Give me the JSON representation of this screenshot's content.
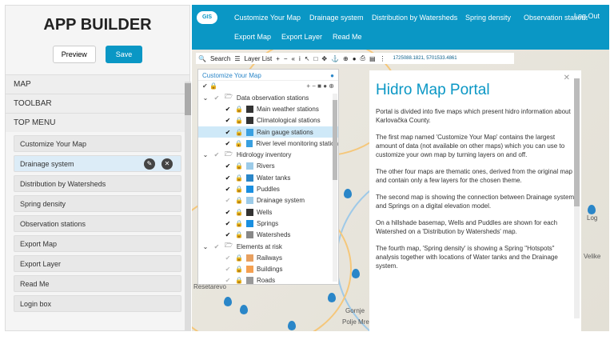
{
  "builder": {
    "title": "APP BUILDER",
    "preview": "Preview",
    "save": "Save",
    "sections": [
      "MAP",
      "TOOLBAR",
      "TOP MENU"
    ],
    "menu_items": [
      "Customize Your Map",
      "Drainage system",
      "Distribution by Watersheds",
      "Spring density",
      "Observation stations",
      "Export Map",
      "Export Layer",
      "Read Me",
      "Login box"
    ],
    "selected": "Drainage system"
  },
  "nav": {
    "logo": "GIS",
    "items": [
      "Customize Your Map",
      "Drainage system",
      "Distribution by Watersheds",
      "Spring density",
      "Observation stations",
      "Export Map",
      "Export Layer",
      "Read Me"
    ],
    "logout": "Log Out"
  },
  "toolbar": {
    "search": "Search",
    "layer_list": "Layer List",
    "coords": "1725088.1821, 5701533.4861"
  },
  "layers": {
    "title": "Customize Your Map",
    "groups": [
      {
        "name": "Data observation stations",
        "items": [
          {
            "name": "Main weather stations",
            "on": true
          },
          {
            "name": "Climatological stations",
            "on": true
          },
          {
            "name": "Rain gauge stations",
            "on": true,
            "selected": true
          },
          {
            "name": "River level monitoring station",
            "on": true
          }
        ]
      },
      {
        "name": "Hidrology inventory",
        "items": [
          {
            "name": "Rivers",
            "on": true
          },
          {
            "name": "Water tanks",
            "on": true
          },
          {
            "name": "Puddles",
            "on": true
          },
          {
            "name": "Drainage system",
            "on": false
          },
          {
            "name": "Wells",
            "on": true
          },
          {
            "name": "Springs",
            "on": true
          },
          {
            "name": "Watersheds",
            "on": true
          }
        ]
      },
      {
        "name": "Elements at risk",
        "items": [
          {
            "name": "Railways",
            "on": false
          },
          {
            "name": "Buildings",
            "on": false
          },
          {
            "name": "Roads",
            "on": false
          }
        ]
      }
    ]
  },
  "map_labels": [
    "Rešetarevo",
    "Gornje",
    "Polje Mrež",
    "Log",
    "Velike"
  ],
  "portal": {
    "title": "Hidro Map Portal",
    "paragraphs": [
      "Portal is divided into five maps which present hidro information about Karlovačka County.",
      "The first map named 'Customize Your Map' contains the largest amount of data (not available on other maps) which you can use to customize your own map by turning layers on and off.",
      "The other four maps are thematic ones, derived from the original map and contain only a few layers for the chosen theme.",
      "The second map is showing the connection between Drainage system and Springs on a digital elevation model.",
      "On a hillshade basemap, Wells and Puddles are shown for each Watershed on a 'Distribution by Watersheds' map.",
      "The fourth map, 'Spring density' is showing a Spring \"Hotspots\" analysis together with locations of Water tanks and the Drainage system."
    ]
  },
  "colors": {
    "accent": "#0a97c5"
  }
}
